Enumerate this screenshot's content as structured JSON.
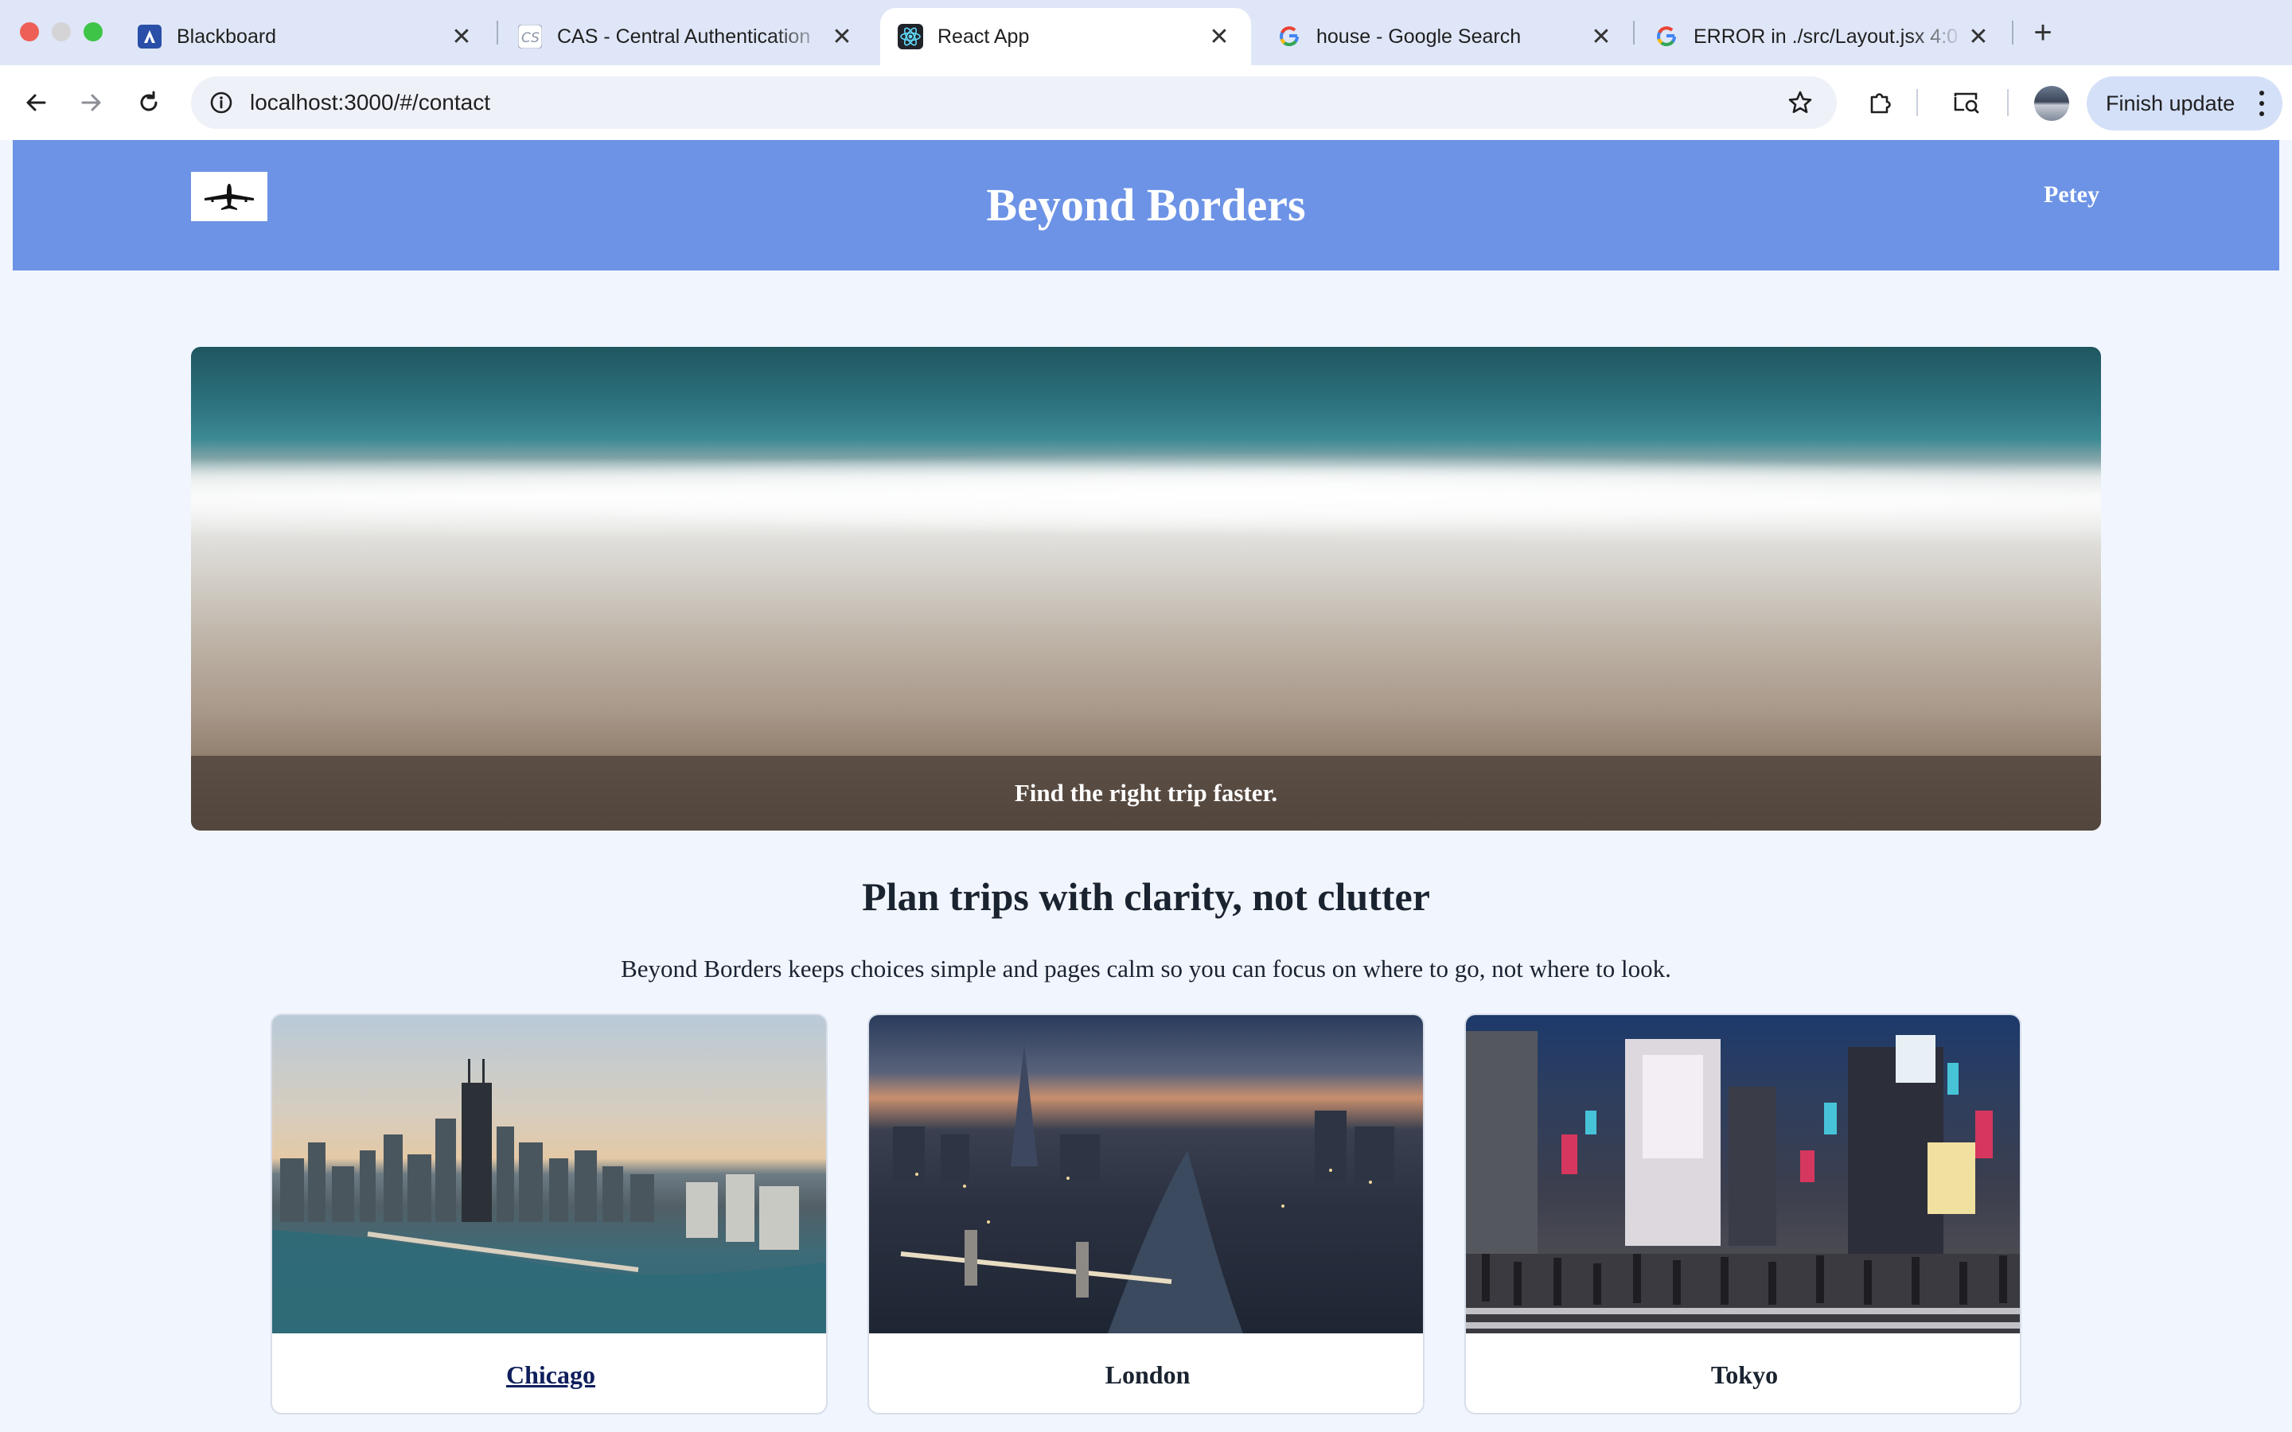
{
  "browser": {
    "tabs": [
      {
        "title": "Blackboard",
        "icon": "blackboard-icon"
      },
      {
        "title": "CAS - Central Authentication",
        "icon": "cas-icon"
      },
      {
        "title": "React App",
        "icon": "react-icon",
        "active": true
      },
      {
        "title": "house - Google Search",
        "icon": "google-icon"
      },
      {
        "title": "ERROR in ./src/Layout.jsx 4:0",
        "icon": "google-icon"
      }
    ],
    "url": "localhost:3000/#/contact",
    "update_button": "Finish update"
  },
  "site": {
    "brand": "Beyond Borders",
    "user": "Petey",
    "hero_caption": "Find the right trip faster.",
    "section_title": "Plan trips with clarity, not clutter",
    "section_subtitle": "Beyond Borders keeps choices simple and pages calm so you can focus on where to go, not where to look.",
    "destinations": [
      {
        "name": "Chicago",
        "hovered": true
      },
      {
        "name": "London"
      },
      {
        "name": "Tokyo"
      }
    ]
  },
  "colors": {
    "header": "#6d93e6",
    "page_background": "#f1f5fd",
    "tabstrip": "#dfe6f7"
  }
}
